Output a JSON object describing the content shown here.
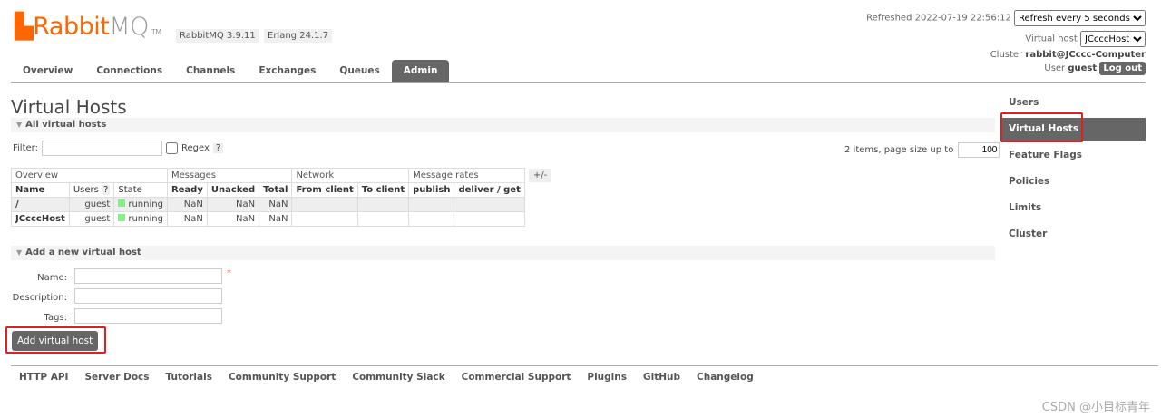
{
  "header": {
    "logo_rabbit": "Rabbit",
    "logo_mq": "MQ",
    "logo_tm": "TM",
    "rabbitmq_version": "RabbitMQ 3.9.11",
    "erlang_version": "Erlang 24.1.7",
    "refreshed": "Refreshed 2022-07-19 22:56:12",
    "refresh_option": "Refresh every 5 seconds",
    "vhost_label": "Virtual host",
    "vhost_value": "JCcccHost",
    "cluster_label": "Cluster",
    "cluster_value": "rabbit@JCccc-Computer",
    "user_label": "User",
    "user_value": "guest",
    "logout": "Log out"
  },
  "nav": [
    "Overview",
    "Connections",
    "Channels",
    "Exchanges",
    "Queues",
    "Admin"
  ],
  "page_title": "Virtual Hosts",
  "all_section": "All virtual hosts",
  "filter": {
    "label": "Filter:",
    "value": "",
    "regex": "Regex",
    "help": "?",
    "items_text": "2 items, page size up to",
    "page_size": "100"
  },
  "table": {
    "groups": [
      "Overview",
      "Messages",
      "Network",
      "Message rates",
      "+/-"
    ],
    "columns": [
      "Name",
      "Users",
      "State",
      "Ready",
      "Unacked",
      "Total",
      "From client",
      "To client",
      "publish",
      "deliver / get"
    ],
    "users_help": "?",
    "rows": [
      {
        "name": "/",
        "users": "guest",
        "state": "running",
        "ready": "NaN",
        "unacked": "NaN",
        "total": "NaN"
      },
      {
        "name": "JCcccHost",
        "users": "guest",
        "state": "running",
        "ready": "NaN",
        "unacked": "NaN",
        "total": "NaN"
      }
    ]
  },
  "add_section": "Add a new virtual host",
  "form": {
    "name": "Name:",
    "description": "Description:",
    "tags": "Tags:",
    "required": "*",
    "submit": "Add virtual host"
  },
  "sidebar": [
    "Users",
    "Virtual Hosts",
    "Feature Flags",
    "Policies",
    "Limits",
    "Cluster"
  ],
  "footer": [
    "HTTP API",
    "Server Docs",
    "Tutorials",
    "Community Support",
    "Community Slack",
    "Commercial Support",
    "Plugins",
    "GitHub",
    "Changelog"
  ],
  "watermark": "CSDN @小目标青年"
}
